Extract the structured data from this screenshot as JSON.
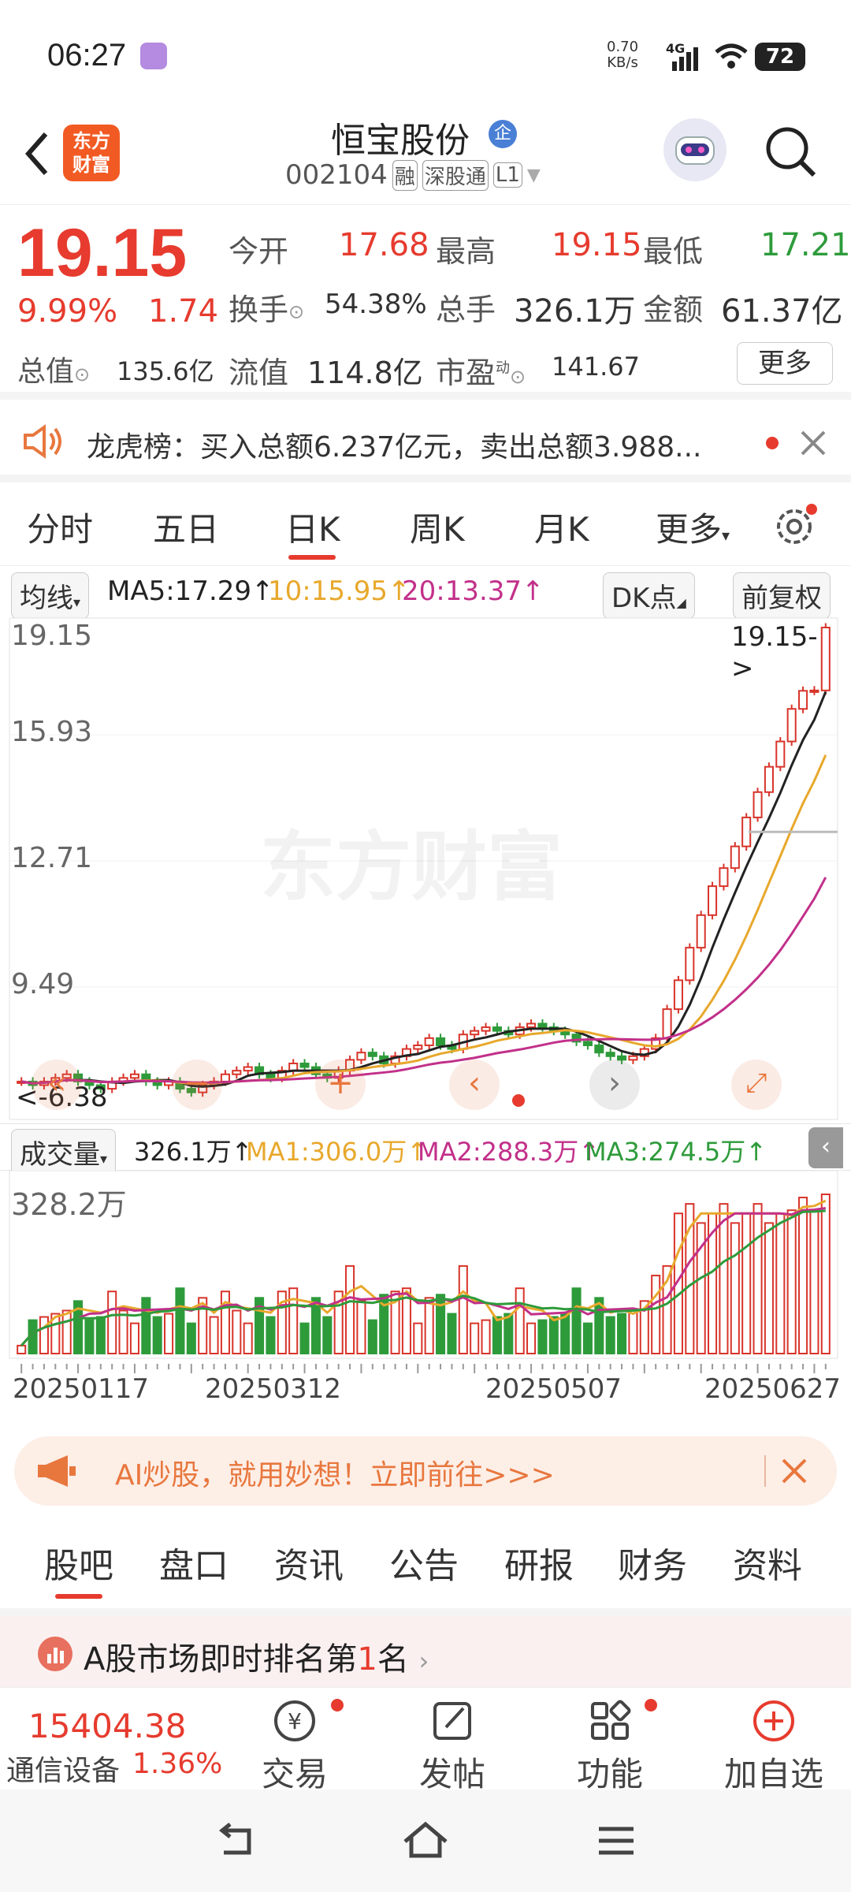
{
  "status_bar": {
    "time": "06:27",
    "net_speed_top": "0.70",
    "net_speed_bottom": "KB/s",
    "network": "4G",
    "battery": "72"
  },
  "header": {
    "stock_name": "恒宝股份",
    "badge": "企",
    "code": "002104",
    "tags": [
      "融",
      "深股通",
      "L1"
    ],
    "brand_line1": "东方",
    "brand_line2": "财富"
  },
  "quote": {
    "price": "19.15",
    "change_pct": "9.99%",
    "change": "1.74",
    "open_label": "今开",
    "open": "17.68",
    "high_label": "最高",
    "high": "19.15",
    "low_label": "最低",
    "low": "17.21",
    "turnover_label": "换手",
    "turnover": "54.38%",
    "volume_label": "总手",
    "volume": "326.1万",
    "amount_label": "金额",
    "amount": "61.37亿",
    "mktcap_label": "总值",
    "mktcap": "135.6亿",
    "float_label": "流值",
    "float": "114.8亿",
    "pe_label": "市盈",
    "pe_sup": "动",
    "pe": "141.67",
    "more": "更多"
  },
  "notice": {
    "text": "龙虎榜：买入总额6.237亿元，卖出总额3.988..."
  },
  "tabs": [
    "分时",
    "五日",
    "日K",
    "周K",
    "月K",
    "更多"
  ],
  "active_tab": "日K",
  "ma_row": {
    "ma_select": "均线",
    "ma5": "MA5:17.29",
    "ma10_20": "10:15.95",
    "ma20": "20:13.37",
    "dk": "DK点",
    "fq": "前复权"
  },
  "price_axis": [
    "19.15",
    "15.93",
    "12.71",
    "9.49"
  ],
  "last_price_tag": "19.15->",
  "low_tag": "6.38",
  "vol_header": {
    "select": "成交量",
    "value": "326.1万",
    "ma1": "MA1:306.0万",
    "ma2": "MA2:288.3万",
    "ma3": "MA3:274.5万"
  },
  "vol_axis": "328.2万",
  "dates": [
    "20250117",
    "20250312",
    "20250507",
    "20250627"
  ],
  "watermark": "东方财富",
  "ai_banner": {
    "text": "AI炒股，就用妙想！立即前往>>>"
  },
  "sub_tabs": [
    "股吧",
    "盘口",
    "资讯",
    "公告",
    "研报",
    "财务",
    "资料"
  ],
  "rank": {
    "prefix": "A股市场即时排名第",
    "num": "1",
    "suffix": "名"
  },
  "bottom": {
    "index_value": "15404.38",
    "index_name": "通信设备",
    "index_change": "1.36%",
    "trade": "交易",
    "post": "发帖",
    "func": "功能",
    "add": "加自选"
  },
  "chart_data": {
    "type": "candlestick",
    "y_range": [
      6.38,
      19.15
    ],
    "close_series": [
      6.6,
      6.5,
      6.6,
      6.7,
      6.8,
      6.6,
      6.5,
      6.4,
      6.6,
      6.7,
      6.8,
      6.6,
      6.5,
      6.6,
      6.4,
      6.3,
      6.5,
      6.6,
      6.8,
      6.9,
      7.0,
      6.8,
      6.7,
      6.9,
      7.1,
      7.0,
      6.8,
      6.7,
      6.9,
      7.2,
      7.4,
      7.3,
      7.1,
      7.3,
      7.5,
      7.6,
      7.8,
      7.6,
      7.5,
      7.9,
      8.0,
      8.1,
      8.0,
      7.9,
      8.1,
      8.2,
      8.1,
      8.0,
      7.9,
      7.7,
      7.6,
      7.4,
      7.3,
      7.2,
      7.3,
      7.5,
      7.8,
      8.6,
      9.4,
      10.3,
      11.2,
      12.0,
      12.5,
      13.1,
      13.9,
      14.6,
      15.3,
      16.0,
      16.9,
      17.4,
      17.41,
      19.15
    ],
    "volume_max": "328.2万"
  }
}
